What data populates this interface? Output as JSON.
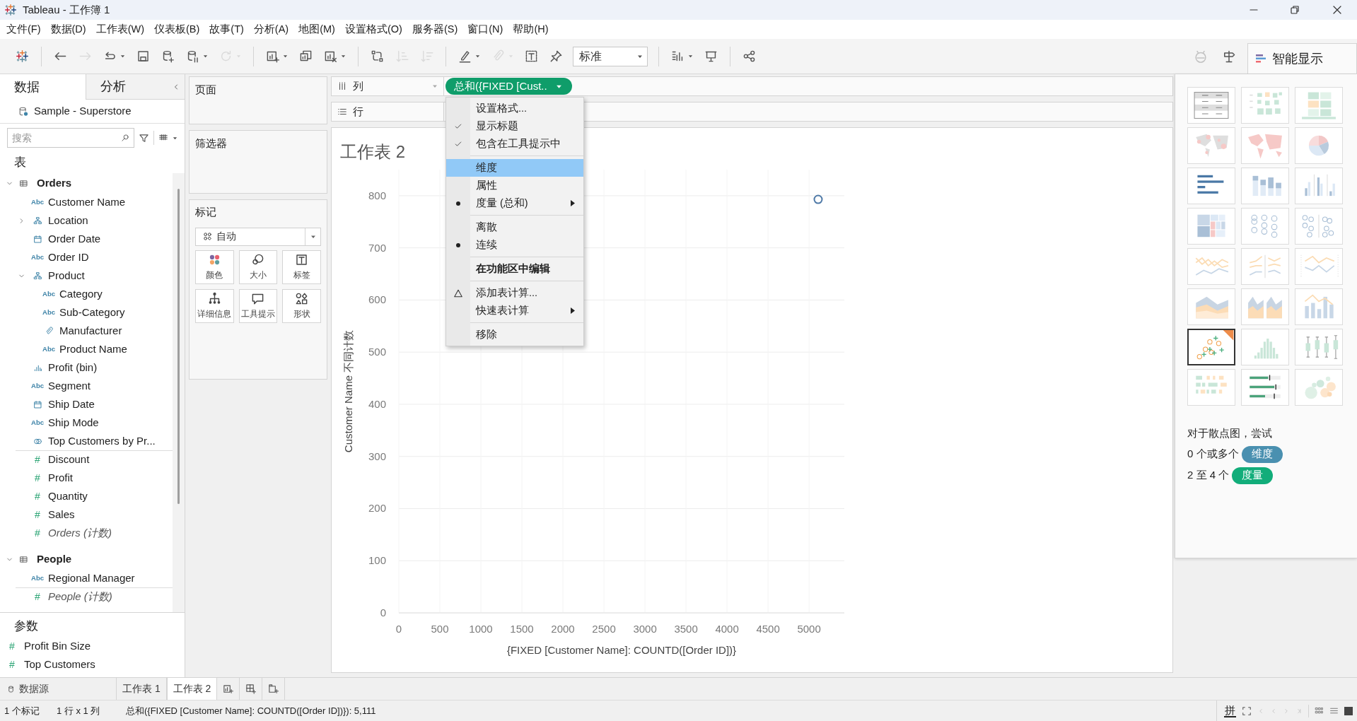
{
  "window": {
    "title": "Tableau - 工作簿 1"
  },
  "menu": [
    "文件(F)",
    "数据(D)",
    "工作表(W)",
    "仪表板(B)",
    "故事(T)",
    "分析(A)",
    "地图(M)",
    "设置格式(O)",
    "服务器(S)",
    "窗口(N)",
    "帮助(H)"
  ],
  "toolbar": [
    {
      "kind": "button",
      "disabled": false,
      "dropdown": false
    },
    {
      "kind": "separator"
    },
    {
      "kind": "button",
      "disabled": false,
      "dropdown": false
    },
    {
      "kind": "button",
      "disabled": true,
      "dropdown": false
    },
    {
      "kind": "button",
      "disabled": false,
      "dropdown": true
    },
    {
      "kind": "button",
      "disabled": false,
      "dropdown": false
    },
    {
      "kind": "button",
      "disabled": false,
      "dropdown": false
    },
    {
      "kind": "button",
      "disabled": false,
      "dropdown": true
    },
    {
      "kind": "button",
      "disabled": true,
      "dropdown": true
    },
    {
      "kind": "separator"
    },
    {
      "kind": "button",
      "disabled": false,
      "dropdown": true
    },
    {
      "kind": "button",
      "disabled": false,
      "dropdown": false
    },
    {
      "kind": "button",
      "disabled": false,
      "dropdown": true
    },
    {
      "kind": "separator"
    },
    {
      "kind": "button",
      "disabled": false,
      "dropdown": false
    },
    {
      "kind": "button",
      "disabled": true,
      "dropdown": false
    },
    {
      "kind": "button",
      "disabled": true,
      "dropdown": false
    },
    {
      "kind": "separator"
    },
    {
      "kind": "button",
      "disabled": false,
      "dropdown": true
    },
    {
      "kind": "button",
      "disabled": true,
      "dropdown": true
    },
    {
      "kind": "button",
      "disabled": false,
      "dropdown": false
    },
    {
      "kind": "button",
      "disabled": false,
      "dropdown": false
    },
    {
      "kind": "select",
      "value": "标准"
    },
    {
      "kind": "separator"
    },
    {
      "kind": "button",
      "disabled": false,
      "dropdown": true
    },
    {
      "kind": "button",
      "disabled": false,
      "dropdown": false
    },
    {
      "kind": "separator"
    },
    {
      "kind": "button",
      "disabled": false,
      "dropdown": false
    }
  ],
  "toolbar_right": [
    {
      "disabled": true
    },
    {
      "disabled": false
    }
  ],
  "show_me_tab": {
    "label": "智能显示",
    "selected": true
  },
  "data_pane": {
    "tabs": [
      {
        "label": "数据",
        "selected": true
      },
      {
        "label": "分析",
        "selected": false
      }
    ],
    "datasource": "Sample - Superstore",
    "search": {
      "placeholder": "搜索"
    },
    "tables_heading": "表",
    "tables": [
      {
        "name": "Orders",
        "expanded": true,
        "children": [
          {
            "name": "Customer Name",
            "kind": "string",
            "badge": "Abc",
            "measure": false
          },
          {
            "name": "Location",
            "kind": "hierarchy",
            "measure": false,
            "expanded": false
          },
          {
            "name": "Order Date",
            "kind": "date",
            "measure": false
          },
          {
            "name": "Order ID",
            "kind": "string",
            "badge": "Abc",
            "measure": false
          },
          {
            "name": "Product",
            "kind": "hierarchy",
            "measure": false,
            "expanded": true,
            "children": [
              {
                "name": "Category",
                "kind": "string",
                "badge": "Abc",
                "measure": false
              },
              {
                "name": "Sub-Category",
                "kind": "string",
                "badge": "Abc",
                "measure": false
              },
              {
                "name": "Manufacturer",
                "kind": "group",
                "measure": false
              },
              {
                "name": "Product Name",
                "kind": "string",
                "badge": "Abc",
                "measure": false
              }
            ]
          },
          {
            "name": "Profit (bin)",
            "kind": "bin",
            "measure": false
          },
          {
            "name": "Segment",
            "kind": "string",
            "badge": "Abc",
            "measure": false
          },
          {
            "name": "Ship Date",
            "kind": "date",
            "measure": false
          },
          {
            "name": "Ship Mode",
            "kind": "string",
            "badge": "Abc",
            "measure": false
          },
          {
            "name": "Top Customers by Pr...",
            "kind": "set",
            "measure": false
          },
          {
            "name": "Discount",
            "kind": "number",
            "badge": "#",
            "measure": true
          },
          {
            "name": "Profit",
            "kind": "number",
            "badge": "#",
            "measure": true
          },
          {
            "name": "Quantity",
            "kind": "number",
            "badge": "#",
            "measure": true
          },
          {
            "name": "Sales",
            "kind": "number",
            "badge": "#",
            "measure": true
          },
          {
            "name": "Orders (计数)",
            "kind": "number",
            "badge": "#",
            "measure": true,
            "italic": true
          }
        ]
      },
      {
        "name": "People",
        "expanded": true,
        "children": [
          {
            "name": "Regional Manager",
            "kind": "string",
            "badge": "Abc",
            "measure": false
          },
          {
            "name": "People (计数)",
            "kind": "number",
            "badge": "#",
            "measure": true,
            "italic": true
          }
        ]
      }
    ],
    "parameters_heading": "参数",
    "parameters": [
      {
        "name": "Profit Bin Size",
        "badge": "#"
      },
      {
        "name": "Top Customers",
        "badge": "#"
      }
    ]
  },
  "cards": {
    "pages": "页面",
    "filters": "筛选器",
    "marks": {
      "title": "标记",
      "type": "自动",
      "buttons": [
        "颜色",
        "大小",
        "标签",
        "详细信息",
        "工具提示",
        "形状"
      ]
    }
  },
  "shelves": [
    {
      "label": "列",
      "pills": [
        {
          "text": "总和({FIXED [Cust..",
          "measure": true
        }
      ]
    },
    {
      "label": "行"
    }
  ],
  "sheet": {
    "title": "工作表 2",
    "chart_data": {
      "type": "scatter",
      "xlabel": "{FIXED [Customer Name]: COUNTD([Order ID])}",
      "ylabel": "Customer Name 不同计数",
      "x": [
        5111
      ],
      "series": [
        {
          "color": "#4e79a7",
          "values": [
            793
          ]
        }
      ],
      "grid": true,
      "xlim": [
        0,
        5430
      ],
      "ylim": [
        0,
        850
      ],
      "xticks": [
        0,
        500,
        1000,
        1500,
        2000,
        2500,
        3000,
        3500,
        4000,
        4500,
        5000
      ],
      "yticks": [
        0,
        100,
        200,
        300,
        400,
        500,
        600,
        700,
        800
      ]
    }
  },
  "context_menu": [
    {
      "kind": "item",
      "label": "设置格式...",
      "selected": false,
      "submenu": false,
      "default": false
    },
    {
      "kind": "check",
      "label": "显示标题",
      "checked": true,
      "selected": false,
      "submenu": false,
      "default": false
    },
    {
      "kind": "check",
      "label": "包含在工具提示中",
      "checked": true,
      "selected": false,
      "submenu": false,
      "default": false
    },
    {
      "kind": "separator"
    },
    {
      "kind": "radio",
      "label": "维度",
      "checked": false,
      "selected": true,
      "submenu": false,
      "default": false
    },
    {
      "kind": "radio",
      "label": "属性",
      "checked": false,
      "selected": false,
      "submenu": false,
      "default": false
    },
    {
      "kind": "radio",
      "label": "度量 (总和)",
      "checked": true,
      "selected": false,
      "submenu": true,
      "default": false
    },
    {
      "kind": "separator"
    },
    {
      "kind": "radio",
      "label": "离散",
      "checked": false,
      "selected": false,
      "submenu": false,
      "default": false
    },
    {
      "kind": "radio",
      "label": "连续",
      "checked": true,
      "selected": false,
      "submenu": false,
      "default": false
    },
    {
      "kind": "separator"
    },
    {
      "kind": "item",
      "label": "在功能区中编辑",
      "selected": false,
      "submenu": false,
      "default": true
    },
    {
      "kind": "separator"
    },
    {
      "kind": "delta",
      "label": "添加表计算...",
      "selected": false,
      "submenu": false,
      "default": false
    },
    {
      "kind": "item",
      "label": "快速表计算",
      "selected": false,
      "submenu": true,
      "default": false
    },
    {
      "kind": "separator"
    },
    {
      "kind": "item",
      "label": "移除",
      "selected": false,
      "submenu": false,
      "default": false
    }
  ],
  "show_me": {
    "charts": [
      {
        "selected": false,
        "recommended": false
      },
      {
        "selected": false,
        "recommended": false
      },
      {
        "selected": false,
        "recommended": false
      },
      {
        "selected": false,
        "recommended": false
      },
      {
        "selected": false,
        "recommended": false
      },
      {
        "selected": false,
        "recommended": false
      },
      {
        "selected": false,
        "recommended": false
      },
      {
        "selected": false,
        "recommended": false
      },
      {
        "selected": false,
        "recommended": false
      },
      {
        "selected": false,
        "recommended": false
      },
      {
        "selected": false,
        "recommended": false
      },
      {
        "selected": false,
        "recommended": false
      },
      {
        "selected": false,
        "recommended": false
      },
      {
        "selected": false,
        "recommended": false
      },
      {
        "selected": false,
        "recommended": false
      },
      {
        "selected": false,
        "recommended": false
      },
      {
        "selected": false,
        "recommended": false
      },
      {
        "selected": false,
        "recommended": false
      },
      {
        "selected": true,
        "recommended": true
      },
      {
        "selected": false,
        "recommended": false
      },
      {
        "selected": false,
        "recommended": false
      },
      {
        "selected": false,
        "recommended": false
      },
      {
        "selected": false,
        "recommended": false
      },
      {
        "selected": false,
        "recommended": false
      }
    ],
    "hint": "对于散点图，尝试",
    "requirements": [
      {
        "count": "0 个或多个",
        "tag": "维度",
        "color": "#4a90b0"
      },
      {
        "count": "2 至 4 个",
        "tag": "度量",
        "color": "#12ad7a"
      }
    ]
  },
  "sheet_tabs": [
    {
      "label": "数据源",
      "kind": "datasource",
      "selected": false
    },
    {
      "label": "工作表 1",
      "kind": "sheet",
      "selected": false
    },
    {
      "label": "工作表 2",
      "kind": "sheet",
      "selected": true
    }
  ],
  "status_bar": {
    "marks": "1 个标记",
    "dims": "1 行 x 1 列",
    "summary": "总和({FIXED [Customer Name]: COUNTD([Order ID])}): 5,111",
    "ime": "拼"
  }
}
